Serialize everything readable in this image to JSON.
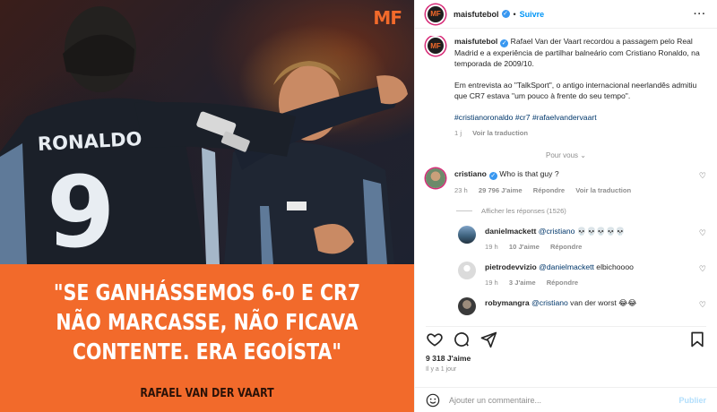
{
  "media": {
    "logo": "MF",
    "shirt_name": "RONALDO",
    "shirt_number": "9",
    "quote_lines": [
      "\"SE GANHÁSSEMOS 6-0 E CR7",
      "NÃO MARCASSE, NÃO FICAVA",
      "CONTENTE. ERA EGOÍSTA\""
    ],
    "author": "RAFAEL VAN DER VAART",
    "accent_color": "#f26a2b"
  },
  "header": {
    "username": "maisfutebol",
    "follow_label": "Suivre",
    "separator": "•",
    "more_icon": "more-horizontal-icon"
  },
  "caption": {
    "username": "maisfutebol",
    "text_1": "Rafael Van der Vaart recordou a passagem pelo Real Madrid e a experiência de partilhar balneário com Cristiano Ronaldo, na temporada de 2009/10.",
    "text_2": "Em entrevista ao \"TalkSport\", o antigo internacional neerlandês admitiu que CR7 estava \"um pouco à frente do seu tempo\".",
    "hashtags": "#cristianoronaldo #cr7 #rafaelvandervaart",
    "time": "1 j",
    "translate": "Voir la traduction"
  },
  "pour_vous": "Pour vous",
  "comments": [
    {
      "username": "cristiano",
      "text": "Who is that guy ?",
      "time": "23 h",
      "likes": "29 796 J'aime",
      "reply": "Répondre",
      "translate": "Voir la traduction"
    }
  ],
  "view_replies": "Afficher les réponses (1526)",
  "replies": [
    {
      "username": "danielmackett",
      "mention": "@cristiano",
      "text": " 💀💀💀💀💀",
      "time": "19 h",
      "likes": "10 J'aime",
      "reply": "Répondre"
    },
    {
      "username": "pietrodevvizio",
      "mention": "@danielmackett",
      "text": " elbichoooo",
      "time": "19 h",
      "likes": "3 J'aime",
      "reply": "Répondre"
    },
    {
      "username": "robymangra",
      "mention": "@cristiano",
      "text": " van der worst 😂😂"
    }
  ],
  "footer": {
    "likes": "9 318 J'aime",
    "ago": "Il y a 1 jour",
    "comment_placeholder": "Ajouter un commentaire...",
    "publish": "Publier"
  }
}
